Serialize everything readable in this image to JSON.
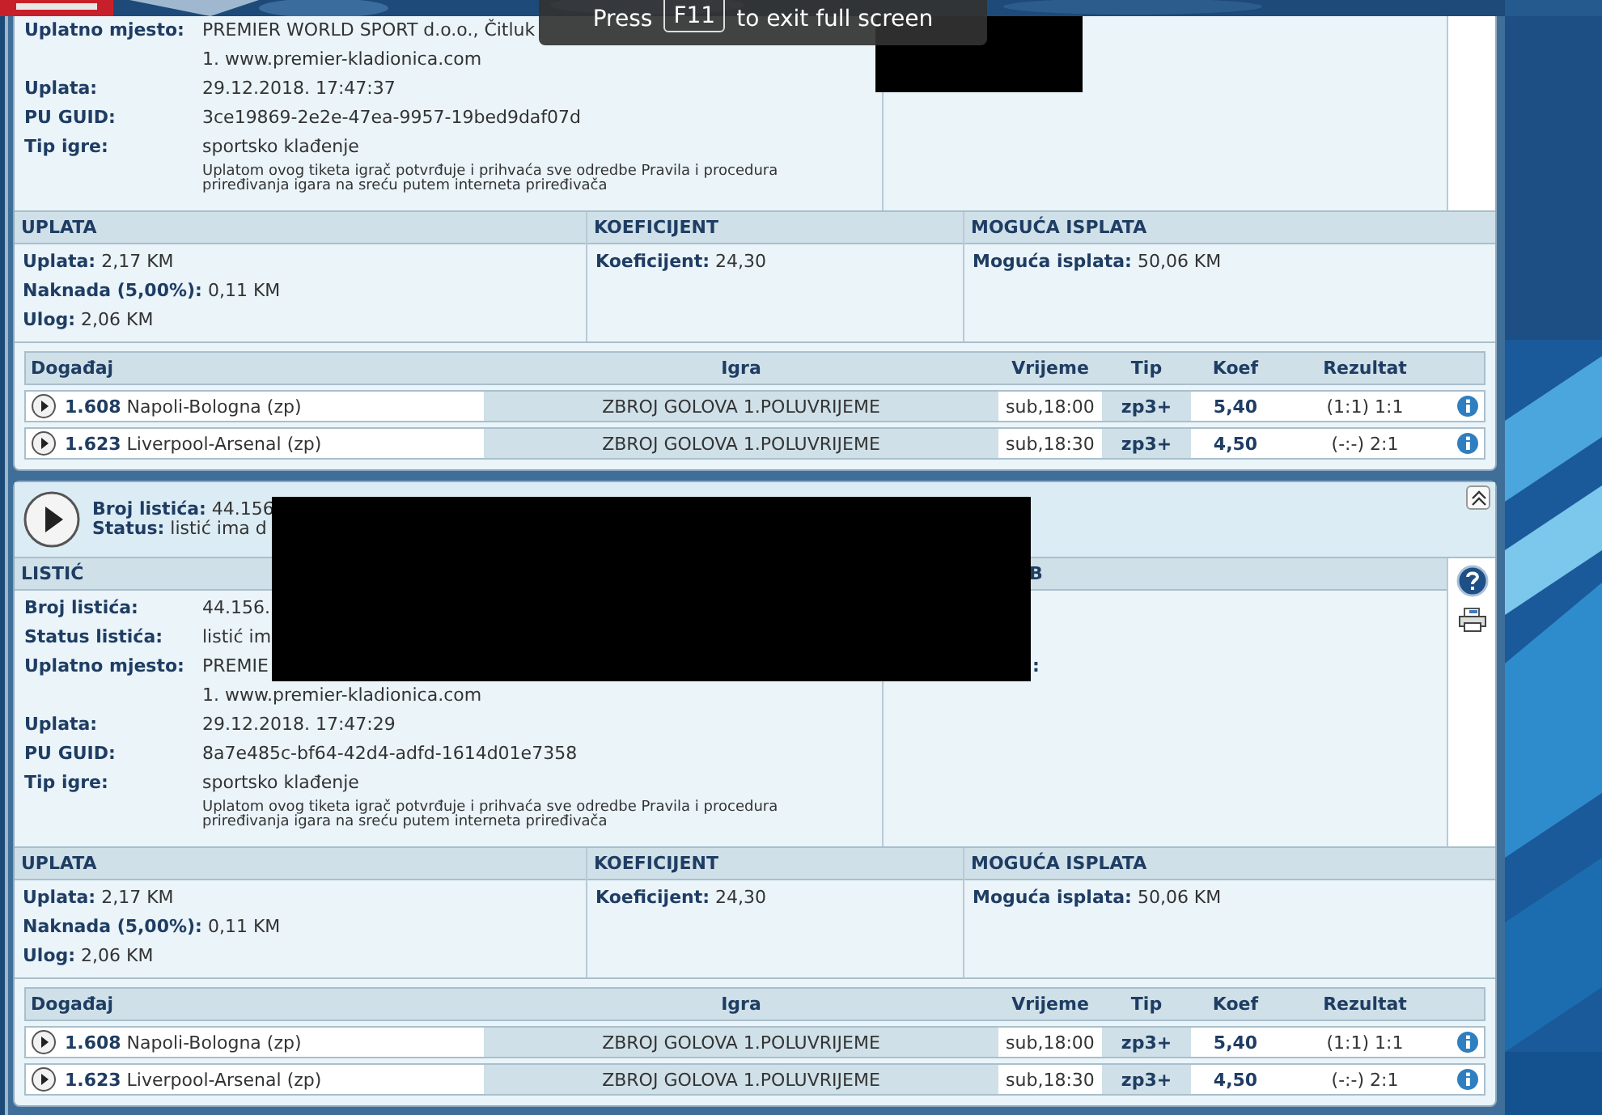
{
  "fullscreen_notice": {
    "before": "Press",
    "key": "F11",
    "after": "to exit full screen"
  },
  "tickets": [
    {
      "tools": false,
      "details": [
        {
          "label": "Uplatno mjesto:",
          "value": "PREMIER WORLD SPORT d.o.o., Čitluk"
        },
        {
          "value": "1. www.premier-kladionica.com"
        },
        {
          "label": "Uplata:",
          "value": "29.12.2018. 17:47:37"
        },
        {
          "label": "PU GUID:",
          "value": "3ce19869-2e2e-47ea-9957-19bed9daf07d"
        },
        {
          "label": "Tip igre:",
          "value": "sportsko klađenje"
        }
      ],
      "notice": "Uplatom ovog tiketa igrač potvrđuje i prihvaća sve odredbe Pravila i procedura priređivanja igara na sreću putem interneta priređivača",
      "summary": [
        {
          "title": "UPLATA",
          "items": [
            {
              "label": "Uplata:",
              "value": "2,17 KM"
            },
            {
              "label": "Naknada (5,00%):",
              "value": "0,11 KM"
            },
            {
              "label": "Ulog:",
              "value": "2,06 KM"
            }
          ]
        },
        {
          "title": "KOEFICIJENT",
          "items": [
            {
              "label": "Koeficijent:",
              "value": "24,30"
            }
          ]
        },
        {
          "title": "MOGUĆA ISPLATA",
          "items": [
            {
              "label": "Moguća isplata:",
              "value": "50,06 KM"
            }
          ]
        }
      ],
      "columns": [
        "Događaj",
        "Igra",
        "Vrijeme",
        "Tip",
        "Koef",
        "Rezultat"
      ],
      "events": [
        {
          "code": "1.608",
          "match": "Napoli-Bologna (zp)",
          "game": "ZBROJ GOLOVA 1.POLUVRIJEME",
          "time": "sub,18:00",
          "tip": "zp3+",
          "koef": "5,40",
          "result": "(1:1) 1:1"
        },
        {
          "code": "1.623",
          "match": "Liverpool-Arsenal (zp)",
          "game": "ZBROJ GOLOVA 1.POLUVRIJEME",
          "time": "sub,18:30",
          "tip": "zp3+",
          "koef": "4,50",
          "result": "(-:-) 2:1"
        }
      ]
    },
    {
      "header": [
        {
          "label": "Broj listića:",
          "value": "44.156"
        },
        {
          "label": "Status:",
          "value": "listić ima d"
        }
      ],
      "collapsible": true,
      "tools": true,
      "section_title": "LISTIĆ",
      "side_header": "B",
      "side_label": ":",
      "details": [
        {
          "label": "Broj listića:",
          "value": "44.156."
        },
        {
          "label": "Status listića:",
          "value": "listić im"
        },
        {
          "label": "Uplatno mjesto:",
          "value": "PREMIE"
        },
        {
          "value": "1. www.premier-kladionica.com"
        },
        {
          "label": "Uplata:",
          "value": "29.12.2018. 17:47:29"
        },
        {
          "label": "PU GUID:",
          "value": "8a7e485c-bf64-42d4-adfd-1614d01e7358"
        },
        {
          "label": "Tip igre:",
          "value": "sportsko klađenje"
        }
      ],
      "notice": "Uplatom ovog tiketa igrač potvrđuje i prihvaća sve odredbe Pravila i procedura priređivanja igara na sreću putem interneta priređivača",
      "summary": [
        {
          "title": "UPLATA",
          "items": [
            {
              "label": "Uplata:",
              "value": "2,17 KM"
            },
            {
              "label": "Naknada (5,00%):",
              "value": "0,11 KM"
            },
            {
              "label": "Ulog:",
              "value": "2,06 KM"
            }
          ]
        },
        {
          "title": "KOEFICIJENT",
          "items": [
            {
              "label": "Koeficijent:",
              "value": "24,30"
            }
          ]
        },
        {
          "title": "MOGUĆA ISPLATA",
          "items": [
            {
              "label": "Moguća isplata:",
              "value": "50,06 KM"
            }
          ]
        }
      ],
      "columns": [
        "Događaj",
        "Igra",
        "Vrijeme",
        "Tip",
        "Koef",
        "Rezultat"
      ],
      "events": [
        {
          "code": "1.608",
          "match": "Napoli-Bologna (zp)",
          "game": "ZBROJ GOLOVA 1.POLUVRIJEME",
          "time": "sub,18:00",
          "tip": "zp3+",
          "koef": "5,40",
          "result": "(1:1) 1:1"
        },
        {
          "code": "1.623",
          "match": "Liverpool-Arsenal (zp)",
          "game": "ZBROJ GOLOVA 1.POLUVRIJEME",
          "time": "sub,18:30",
          "tip": "zp3+",
          "koef": "4,50",
          "result": "(-:-) 2:1"
        }
      ]
    }
  ]
}
